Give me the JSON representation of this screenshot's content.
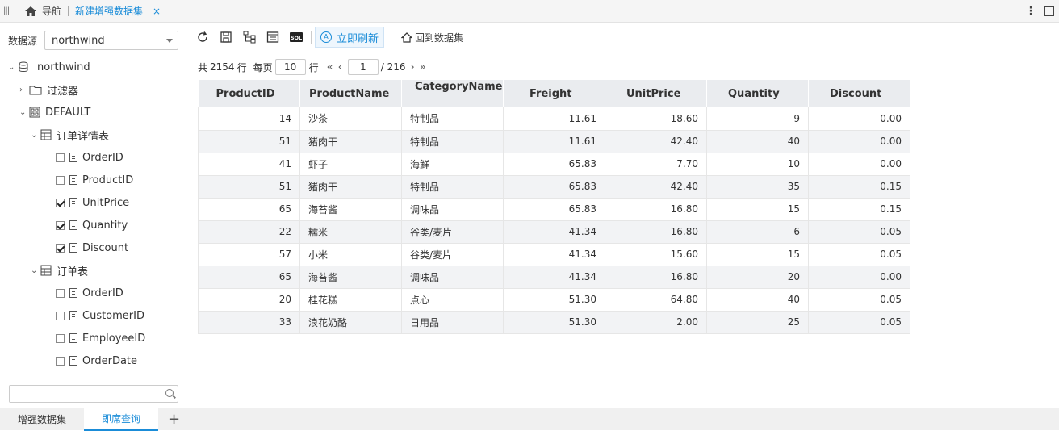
{
  "topbar": {
    "nav_label": "导航",
    "active_tab": "新建增强数据集",
    "close": "×"
  },
  "datasource": {
    "label": "数据源",
    "value": "northwind"
  },
  "tree": {
    "root": "northwind",
    "filter": "过滤器",
    "default": "DEFAULT",
    "table1": {
      "name": "订单详情表",
      "fields": [
        {
          "name": "OrderID",
          "checked": false
        },
        {
          "name": "ProductID",
          "checked": false
        },
        {
          "name": "UnitPrice",
          "checked": true
        },
        {
          "name": "Quantity",
          "checked": true
        },
        {
          "name": "Discount",
          "checked": true
        }
      ]
    },
    "table2": {
      "name": "订单表",
      "fields": [
        {
          "name": "OrderID",
          "checked": false
        },
        {
          "name": "CustomerID",
          "checked": false
        },
        {
          "name": "EmployeeID",
          "checked": false
        },
        {
          "name": "OrderDate",
          "checked": false
        }
      ]
    }
  },
  "toolbar": {
    "refresh_label": "立即刷新",
    "back_label": "回到数据集",
    "sql_label": "SQL"
  },
  "pager": {
    "total_prefix": "共",
    "total": "2154",
    "total_suffix": "行",
    "per_page_label": "每页",
    "per_page": "10",
    "per_page_suffix": "行",
    "page": "1",
    "pages": "/ 216"
  },
  "table": {
    "columns": [
      "ProductID",
      "ProductName",
      "CategoryName",
      "Freight",
      "UnitPrice",
      "Quantity",
      "Discount"
    ],
    "rows": [
      [
        "14",
        "沙茶",
        "特制品",
        "11.61",
        "18.60",
        "9",
        "0.00"
      ],
      [
        "51",
        "猪肉干",
        "特制品",
        "11.61",
        "42.40",
        "40",
        "0.00"
      ],
      [
        "41",
        "虾子",
        "海鲜",
        "65.83",
        "7.70",
        "10",
        "0.00"
      ],
      [
        "51",
        "猪肉干",
        "特制品",
        "65.83",
        "42.40",
        "35",
        "0.15"
      ],
      [
        "65",
        "海苔酱",
        "调味品",
        "65.83",
        "16.80",
        "15",
        "0.15"
      ],
      [
        "22",
        "糯米",
        "谷类/麦片",
        "41.34",
        "16.80",
        "6",
        "0.05"
      ],
      [
        "57",
        "小米",
        "谷类/麦片",
        "41.34",
        "15.60",
        "15",
        "0.05"
      ],
      [
        "65",
        "海苔酱",
        "调味品",
        "41.34",
        "16.80",
        "20",
        "0.00"
      ],
      [
        "20",
        "桂花糕",
        "点心",
        "51.30",
        "64.80",
        "40",
        "0.05"
      ],
      [
        "33",
        "浪花奶酪",
        "日用品",
        "51.30",
        "2.00",
        "25",
        "0.05"
      ]
    ]
  },
  "bottom_tabs": [
    "增强数据集",
    "即席查询"
  ],
  "bottom_add": "+"
}
